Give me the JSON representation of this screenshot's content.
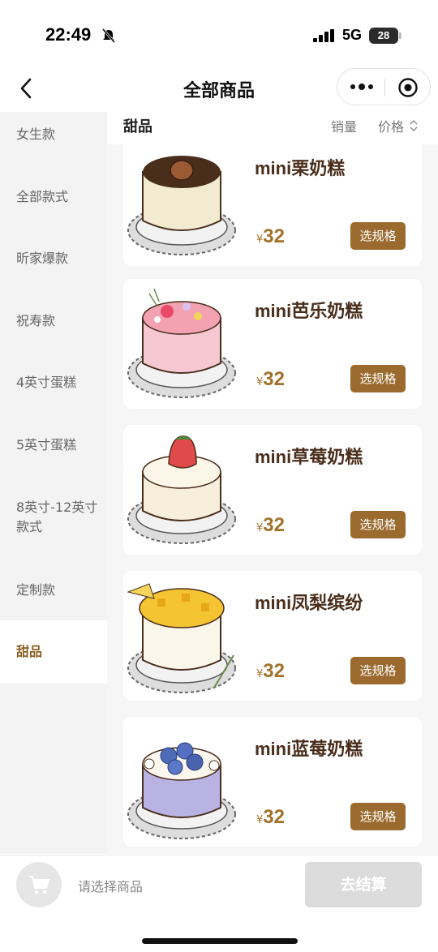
{
  "status_bar": {
    "time": "22:49",
    "network": "5G",
    "battery": "28"
  },
  "navbar": {
    "title": "全部商品"
  },
  "sidebar": {
    "items": [
      {
        "label": "女生款",
        "active": false
      },
      {
        "label": "全部款式",
        "active": false
      },
      {
        "label": "昕家爆款",
        "active": false
      },
      {
        "label": "祝寿款",
        "active": false
      },
      {
        "label": "4英寸蛋糕",
        "active": false
      },
      {
        "label": "5英寸蛋糕",
        "active": false
      },
      {
        "label": "8英寸-12英寸款式",
        "active": false
      },
      {
        "label": "定制款",
        "active": false
      },
      {
        "label": "甜品",
        "active": true
      }
    ]
  },
  "list_header": {
    "category": "甜品",
    "sort_sales": "销量",
    "sort_price": "价格"
  },
  "products": [
    {
      "name": "mini栗奶糕",
      "currency": "¥",
      "price": "32",
      "button": "选规格",
      "cake_color": "#f3ead2",
      "topping": "chestnut"
    },
    {
      "name": "mini芭乐奶糕",
      "currency": "¥",
      "price": "32",
      "button": "选规格",
      "cake_color": "#f6c9d2",
      "topping": "flowers"
    },
    {
      "name": "mini草莓奶糕",
      "currency": "¥",
      "price": "32",
      "button": "选规格",
      "cake_color": "#f7efdc",
      "topping": "strawberry"
    },
    {
      "name": "mini凤梨缤纷",
      "currency": "¥",
      "price": "32",
      "button": "选规格",
      "cake_color": "#fbf6ea",
      "topping": "pineapple"
    },
    {
      "name": "mini蓝莓奶糕",
      "currency": "¥",
      "price": "32",
      "button": "选规格",
      "cake_color": "#b8b3e2",
      "topping": "blueberry"
    }
  ],
  "bottom_bar": {
    "hint": "请选择商品",
    "checkout": "去结算"
  },
  "colors": {
    "accent": "#9b6a2e",
    "active_text": "#8b6226",
    "price": "#a2712b"
  }
}
